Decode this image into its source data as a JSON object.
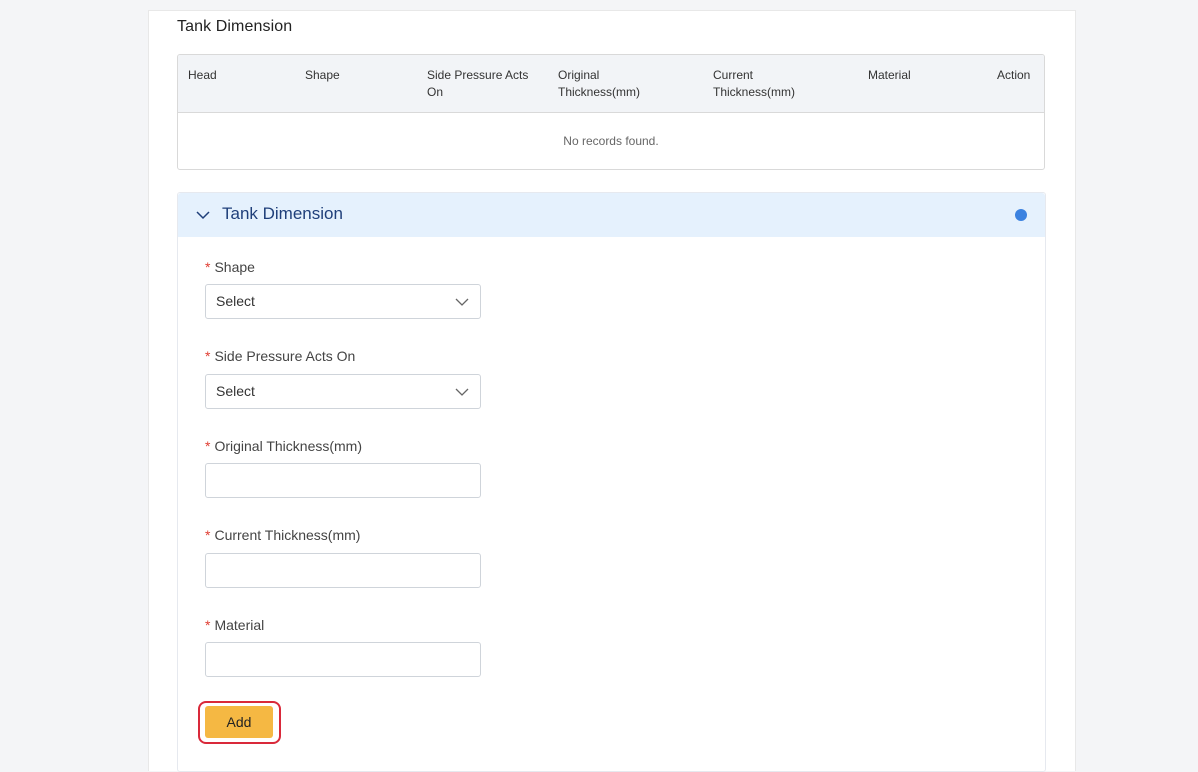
{
  "section": {
    "title": "Tank Dimension"
  },
  "table": {
    "columns": [
      {
        "line1": "Head",
        "line2": ""
      },
      {
        "line1": "Shape",
        "line2": ""
      },
      {
        "line1": "Side Pressure Acts",
        "line2": "On"
      },
      {
        "line1": "Original",
        "line2": "Thickness(mm)"
      },
      {
        "line1": "Current",
        "line2": "Thickness(mm)"
      },
      {
        "line1": "Material",
        "line2": ""
      },
      {
        "line1": "Action",
        "line2": ""
      }
    ],
    "empty_message": "No records found."
  },
  "panel": {
    "title": "Tank Dimension",
    "required_marker": "*",
    "fields": {
      "shape": {
        "label": "Shape",
        "value": "Select"
      },
      "side_pressure": {
        "label": "Side Pressure Acts On",
        "value": "Select"
      },
      "original_thickness": {
        "label": "Original Thickness(mm)",
        "value": ""
      },
      "current_thickness": {
        "label": "Current Thickness(mm)",
        "value": ""
      },
      "material": {
        "label": "Material",
        "value": ""
      }
    },
    "add_button": "Add"
  },
  "colors": {
    "accent_dot": "#3b82e0",
    "add_button": "#f5b843",
    "highlight_outline": "#d9293a",
    "panel_header_bg": "#e5f1fd"
  }
}
